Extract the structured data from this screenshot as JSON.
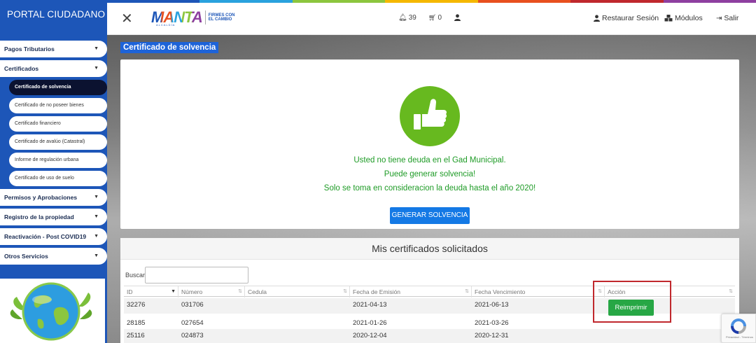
{
  "sidebar": {
    "title": "PORTAL CIUDADANO",
    "menu": [
      {
        "label": "Pagos Tributarios"
      },
      {
        "label": "Certificados"
      },
      {
        "label": "Permisos y Aprobaciones"
      },
      {
        "label": "Registro de la propiedad"
      },
      {
        "label": "Reactivación - Post COVID19"
      },
      {
        "label": "Otros Servicios"
      }
    ],
    "submenu": [
      {
        "label": "Certificado de solvencia"
      },
      {
        "label": "Certificado de no poseer bienes"
      },
      {
        "label": "Certificado financiero"
      },
      {
        "label": "Certificado de avalúo (Catastral)"
      },
      {
        "label": "Informe de regulación urbana"
      },
      {
        "label": "Certificado de uso de suelo"
      }
    ]
  },
  "header": {
    "logo_word": "MANTA",
    "logo_tagline_1": "FIRMES CON",
    "logo_tagline_2": "EL CAMBIO",
    "logo_sub": "ALCALDÍA",
    "notifications_count": "39",
    "cart_count": "0",
    "restore_label": "Restaurar Sesión",
    "modules_label": "Módulos",
    "exit_label": "Salir",
    "stripe_colors": [
      "#1d56b8",
      "#2aa2de",
      "#8cc63e",
      "#f5b800",
      "#e8501e",
      "#c0282d",
      "#8e3fa0"
    ]
  },
  "page": {
    "section_title": "Certificado de solvencia",
    "message_1": "Usted no tiene deuda en el Gad Municipal.",
    "message_2": "Puede generar solvencia!",
    "message_3": "Solo se toma en consideracion la deuda hasta el año 2020!",
    "generate_button": "GENERAR SOLVENCIA"
  },
  "certificates": {
    "title": "Mis certificados solicitados",
    "search_label": "Buscar:",
    "search_value": "",
    "columns": [
      "ID",
      "Número",
      "Cedula",
      "Fecha de Emisión",
      "Fecha Vencimiento",
      "Acción"
    ],
    "rows": [
      {
        "id": "32276",
        "numero": "031706",
        "cedula": "",
        "emision": "2021-04-13",
        "vencimiento": "2021-06-13"
      },
      {
        "id": "28185",
        "numero": "027654",
        "cedula": "",
        "emision": "2021-01-26",
        "vencimiento": "2021-03-26"
      },
      {
        "id": "25116",
        "numero": "024873",
        "cedula": "",
        "emision": "2020-12-04",
        "vencimiento": "2020-12-31"
      }
    ],
    "reprint_label": "Reimprimir"
  },
  "recaptcha": {
    "sub": "Privacidad - Términos"
  }
}
